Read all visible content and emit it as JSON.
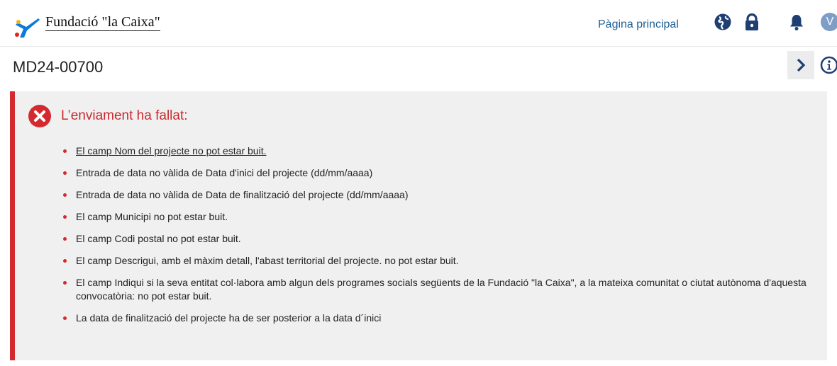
{
  "header": {
    "brand": "Fundació \"la Caixa\"",
    "home_link": "Pàgina principal",
    "avatar_initial": "V",
    "icons": [
      "globe-icon",
      "lock-icon",
      "bell-icon"
    ]
  },
  "page": {
    "title": "MD24-00700"
  },
  "alert": {
    "title": "L’enviament ha fallat:",
    "errors": [
      "El camp Nom del projecte no pot estar buit.",
      "Entrada de data no vàlida de Data d'inici del projecte (dd/mm/aaaa)",
      "Entrada de data no vàlida de Data de finalització del projecte (dd/mm/aaaa)",
      "El camp Municipi no pot estar buit.",
      "El camp Codi postal no pot estar buit.",
      "El camp Descrigui, amb el màxim detall, l'abast territorial del projecte. no pot estar buit.",
      "El camp Indiqui si la seva entitat col·labora amb algun dels programes socials següents de la Fundació \"la Caixa\", a la mateixa comunitat o ciutat autònoma d'aquesta convocatòria: no pot estar buit.",
      "La data de finalització del projecte ha de ser posterior a la data d´inici"
    ]
  },
  "colors": {
    "error_red": "#d42a2f",
    "link_blue": "#1a5f96",
    "brand_blue": "#0a7bd6",
    "icon_navy": "#1f3f73"
  }
}
